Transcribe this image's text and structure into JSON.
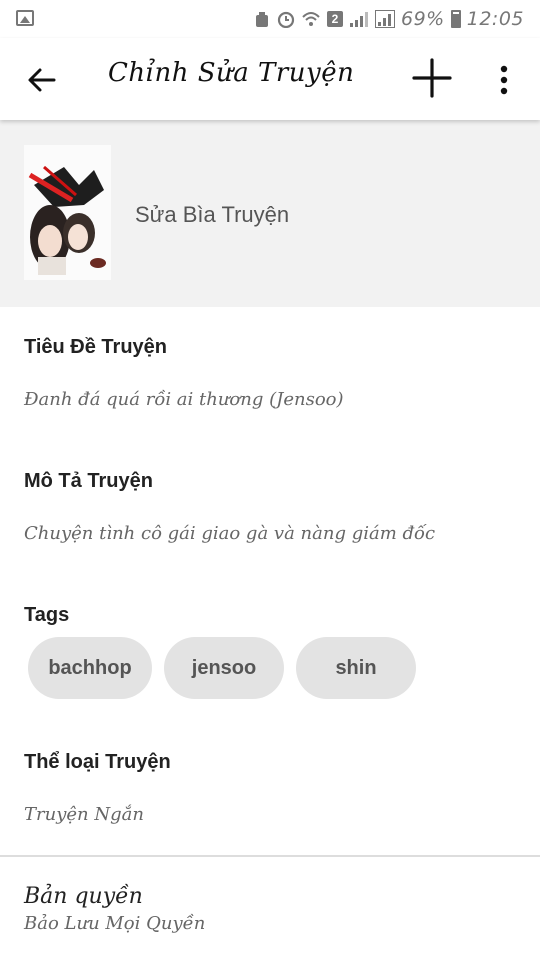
{
  "status_bar": {
    "sim_badge": "2",
    "battery": "69%",
    "time": "12:05"
  },
  "app_bar": {
    "title": "Chỉnh Sửa Truyện"
  },
  "cover": {
    "label": "Sửa Bìa Truyện"
  },
  "fields": {
    "title": {
      "label": "Tiêu Đề Truyện",
      "value": "Đanh đá quá rồi ai thương (Jensoo)"
    },
    "description": {
      "label": "Mô Tả Truyện",
      "value": "Chuyện tình cô gái giao gà và nàng giám đốc"
    },
    "tags": {
      "label": "Tags",
      "items": [
        "bachhop",
        "jensoo",
        "shin"
      ]
    },
    "category": {
      "label": "Thể loại Truyện",
      "value": "Truyện Ngắn"
    },
    "copyright": {
      "label": "Bản quyền",
      "value": "Bảo Lưu Mọi Quyền"
    }
  },
  "icons": {
    "status_left": "gallery-icon",
    "status_right": [
      "recycle-icon",
      "alarm-icon",
      "wifi-icon",
      "signal-icon",
      "signal-icon",
      "battery-icon"
    ],
    "app_bar": [
      "back-arrow-icon",
      "plus-icon",
      "more-vert-icon"
    ]
  }
}
